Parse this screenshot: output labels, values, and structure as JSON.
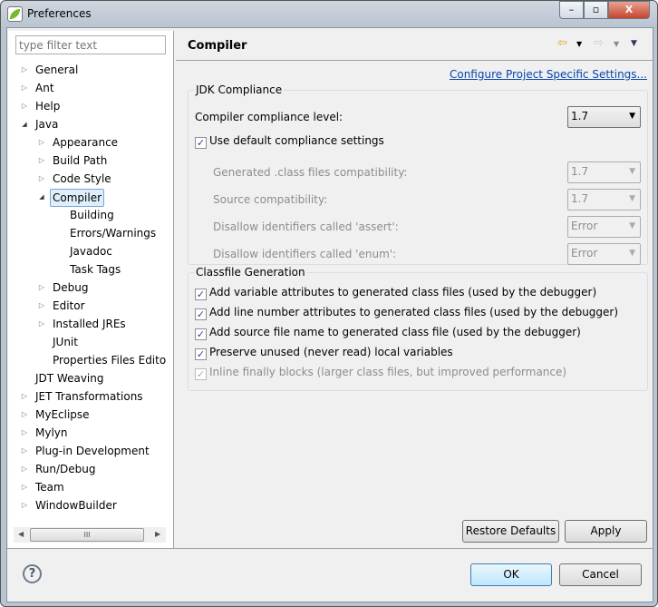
{
  "window": {
    "title": "Preferences",
    "minimize": "–",
    "maximize": "▫",
    "close": "X"
  },
  "filter": {
    "placeholder": "type filter text"
  },
  "tree": [
    {
      "label": "General",
      "level": 0,
      "state": "closed"
    },
    {
      "label": "Ant",
      "level": 0,
      "state": "closed"
    },
    {
      "label": "Help",
      "level": 0,
      "state": "closed"
    },
    {
      "label": "Java",
      "level": 0,
      "state": "open"
    },
    {
      "label": "Appearance",
      "level": 1,
      "state": "closed"
    },
    {
      "label": "Build Path",
      "level": 1,
      "state": "closed"
    },
    {
      "label": "Code Style",
      "level": 1,
      "state": "closed"
    },
    {
      "label": "Compiler",
      "level": 1,
      "state": "open",
      "selected": true
    },
    {
      "label": "Building",
      "level": 2,
      "state": "none"
    },
    {
      "label": "Errors/Warnings",
      "level": 2,
      "state": "none"
    },
    {
      "label": "Javadoc",
      "level": 2,
      "state": "none"
    },
    {
      "label": "Task Tags",
      "level": 2,
      "state": "none"
    },
    {
      "label": "Debug",
      "level": 1,
      "state": "closed"
    },
    {
      "label": "Editor",
      "level": 1,
      "state": "closed"
    },
    {
      "label": "Installed JREs",
      "level": 1,
      "state": "closed"
    },
    {
      "label": "JUnit",
      "level": 1,
      "state": "none"
    },
    {
      "label": "Properties Files Edito",
      "level": 1,
      "state": "none"
    },
    {
      "label": "JDT Weaving",
      "level": 0,
      "state": "none"
    },
    {
      "label": "JET Transformations",
      "level": 0,
      "state": "closed"
    },
    {
      "label": "MyEclipse",
      "level": 0,
      "state": "closed"
    },
    {
      "label": "Mylyn",
      "level": 0,
      "state": "closed"
    },
    {
      "label": "Plug-in Development",
      "level": 0,
      "state": "closed"
    },
    {
      "label": "Run/Debug",
      "level": 0,
      "state": "closed"
    },
    {
      "label": "Team",
      "level": 0,
      "state": "closed"
    },
    {
      "label": "WindowBuilder",
      "level": 0,
      "state": "closed"
    }
  ],
  "scrollbar": {
    "grip": "III"
  },
  "page": {
    "title": "Compiler",
    "back_icon": "⇦",
    "forward_icon": "⇨",
    "menu_icon": "▼",
    "link": "Configure Project Specific Settings..."
  },
  "jdk": {
    "title": "JDK Compliance",
    "level_label": "Compiler compliance level:",
    "level_value": "1.7",
    "use_default": {
      "label": "Use default compliance settings",
      "checked": true
    },
    "rows": [
      {
        "label": "Generated .class files compatibility:",
        "value": "1.7"
      },
      {
        "label": "Source compatibility:",
        "value": "1.7"
      },
      {
        "label": "Disallow identifiers called 'assert':",
        "value": "Error"
      },
      {
        "label": "Disallow identifiers called 'enum':",
        "value": "Error"
      }
    ]
  },
  "classfile": {
    "title": "Classfile Generation",
    "options": [
      {
        "label": "Add variable attributes to generated class files (used by the debugger)",
        "checked": true,
        "enabled": true
      },
      {
        "label": "Add line number attributes to generated class files (used by the debugger)",
        "checked": true,
        "enabled": true
      },
      {
        "label": "Add source file name to generated class file (used by the debugger)",
        "checked": true,
        "enabled": true
      },
      {
        "label": "Preserve unused (never read) local variables",
        "checked": true,
        "enabled": true
      },
      {
        "label": "Inline finally blocks (larger class files, but improved performance)",
        "checked": true,
        "enabled": false
      }
    ]
  },
  "buttons": {
    "restore": "Restore Defaults",
    "apply": "Apply",
    "ok": "OK",
    "cancel": "Cancel",
    "help": "?"
  }
}
